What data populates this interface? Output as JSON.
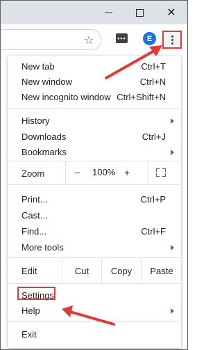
{
  "window": {
    "minimize_icon": "minimize-icon",
    "maximize_icon": "maximize-icon",
    "close_glyph": "✕"
  },
  "toolbar": {
    "star_glyph": "☆",
    "extension_glyph": "•••",
    "avatar_letter": "E",
    "menu_icon": "vertical-dots-icon"
  },
  "menu": {
    "new_tab": {
      "label": "New tab",
      "shortcut": "Ctrl+T"
    },
    "new_window": {
      "label": "New window",
      "shortcut": "Ctrl+N"
    },
    "new_incognito": {
      "label": "New incognito window",
      "shortcut": "Ctrl+Shift+N"
    },
    "history": {
      "label": "History"
    },
    "downloads": {
      "label": "Downloads",
      "shortcut": "Ctrl+J"
    },
    "bookmarks": {
      "label": "Bookmarks"
    },
    "zoom": {
      "label": "Zoom",
      "minus": "–",
      "value": "100%",
      "plus": "+"
    },
    "print": {
      "label": "Print...",
      "shortcut": "Ctrl+P"
    },
    "cast": {
      "label": "Cast..."
    },
    "find": {
      "label": "Find...",
      "shortcut": "Ctrl+F"
    },
    "more_tools": {
      "label": "More tools"
    },
    "edit": {
      "label": "Edit",
      "cut": "Cut",
      "copy": "Copy",
      "paste": "Paste"
    },
    "settings": {
      "label": "Settings"
    },
    "help": {
      "label": "Help"
    },
    "exit": {
      "label": "Exit"
    }
  },
  "colors": {
    "highlight": "#e53935",
    "titlebar": "#dee1e6",
    "avatar": "#1a73e8"
  }
}
